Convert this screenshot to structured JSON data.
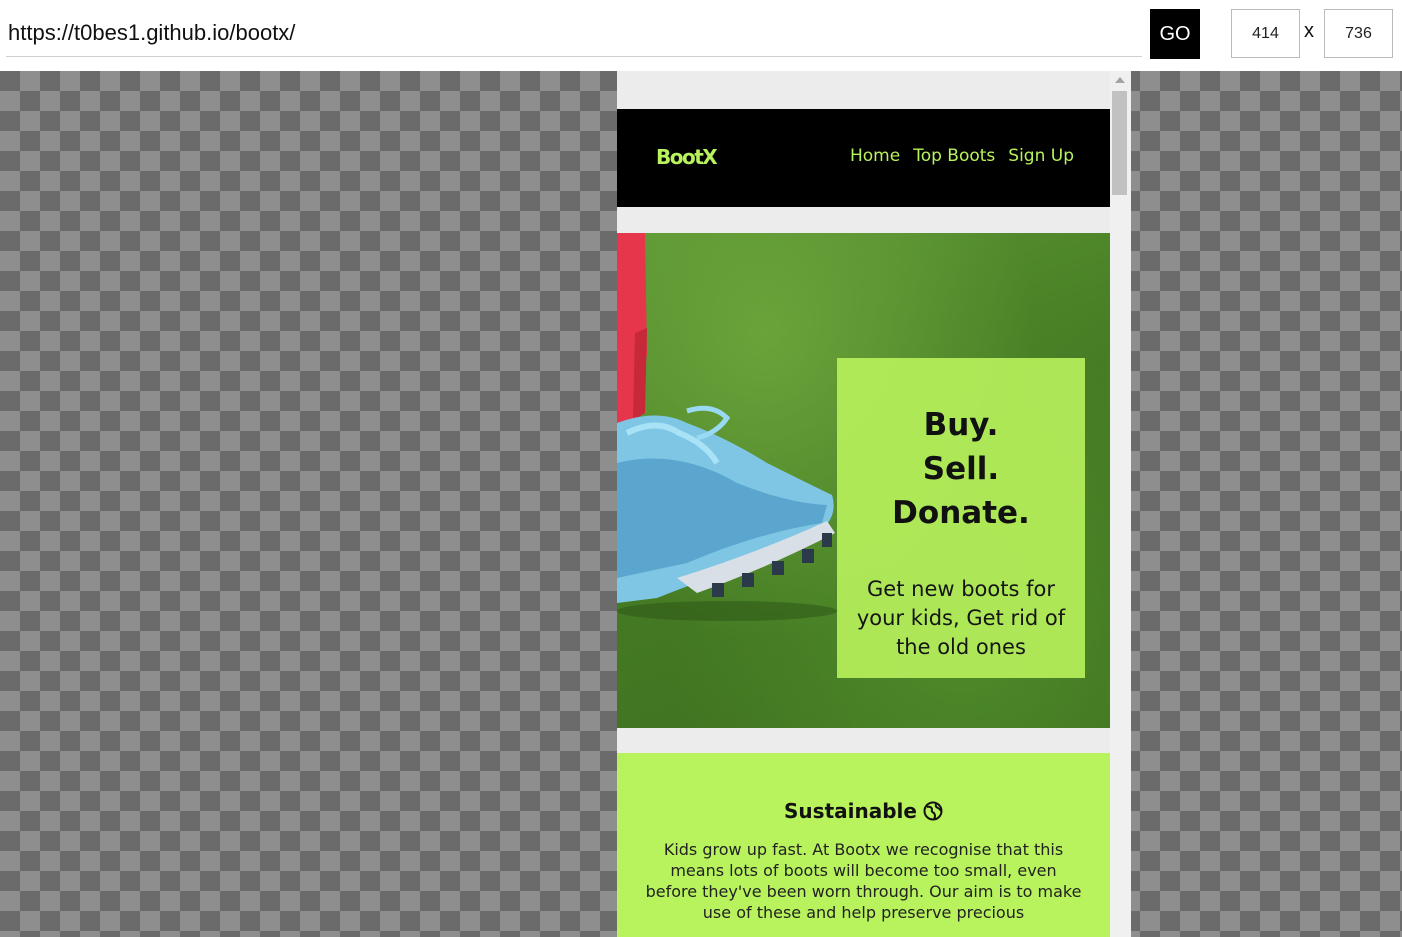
{
  "toolbar": {
    "url_value": "https://t0bes1.github.io/bootx/",
    "go_label": "GO",
    "width_value": "414",
    "height_value": "736",
    "separator": "x"
  },
  "site": {
    "logo": "BootX",
    "nav": [
      "Home",
      "Top Boots",
      "Sign Up"
    ],
    "hero": {
      "title": "Buy.\nSell.\nDonate.",
      "subtitle": "Get new boots for your kids, Get rid of the old ones"
    },
    "sustainable": {
      "title": "Sustainable",
      "body": "Kids grow up fast. At Bootx we recognise that this means lots of boots will become too small, even before they've been worn through. Our aim is to make use of these and help preserve precious"
    }
  },
  "colors": {
    "accent": "#b8f25c",
    "header_bg": "#000000",
    "go_bg": "#000000"
  }
}
